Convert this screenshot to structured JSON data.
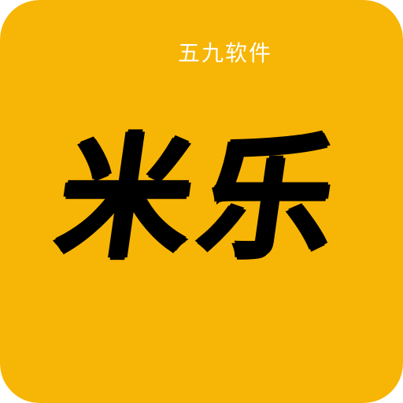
{
  "icon": {
    "background_color": "#F7B505",
    "brand_text": "五九软件",
    "app_name": "米乐",
    "brand_text_color": "#FFFFFF",
    "app_name_color": "#000000"
  }
}
